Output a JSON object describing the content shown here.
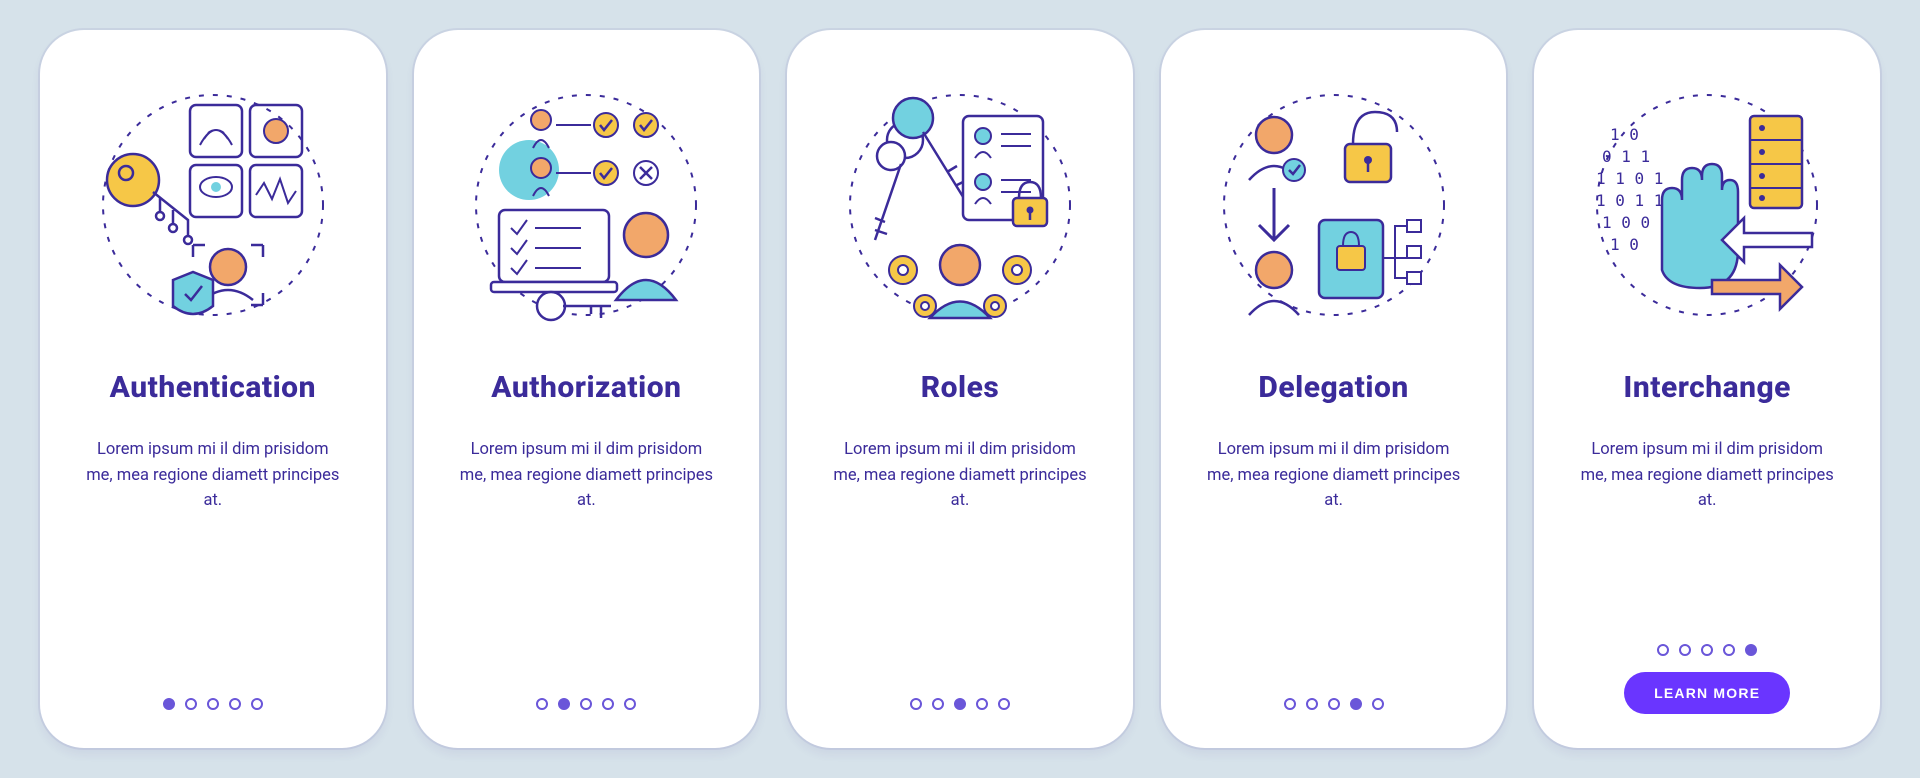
{
  "colors": {
    "background": "#D6E2EA",
    "card": "#FFFFFF",
    "indigo_text": "#3B2B9A",
    "dot": "#6A56D9",
    "cta": "#6A35FF",
    "accent_teal": "#72D1E0",
    "accent_yellow": "#F6C747",
    "accent_peach": "#F2A76A"
  },
  "cta_label": "LEARN MORE",
  "total_slides": 5,
  "cards": [
    {
      "title": "Authentication",
      "description": "Lorem ipsum mi il dim prisidom me, mea regione diamett principes at.",
      "icon": "authentication-icon",
      "active_index": 0,
      "has_cta": false
    },
    {
      "title": "Authorization",
      "description": "Lorem ipsum mi il dim prisidom me, mea regione diamett principes at.",
      "icon": "authorization-icon",
      "active_index": 1,
      "has_cta": false
    },
    {
      "title": "Roles",
      "description": "Lorem ipsum mi il dim prisidom me, mea regione diamett principes at.",
      "icon": "roles-icon",
      "active_index": 2,
      "has_cta": false
    },
    {
      "title": "Delegation",
      "description": "Lorem ipsum mi il dim prisidom me, mea regione diamett principes at.",
      "icon": "delegation-icon",
      "active_index": 3,
      "has_cta": false
    },
    {
      "title": "Interchange",
      "description": "Lorem ipsum mi il dim prisidom me, mea regione diamett principes at.",
      "icon": "interchange-icon",
      "active_index": 4,
      "has_cta": true
    }
  ]
}
